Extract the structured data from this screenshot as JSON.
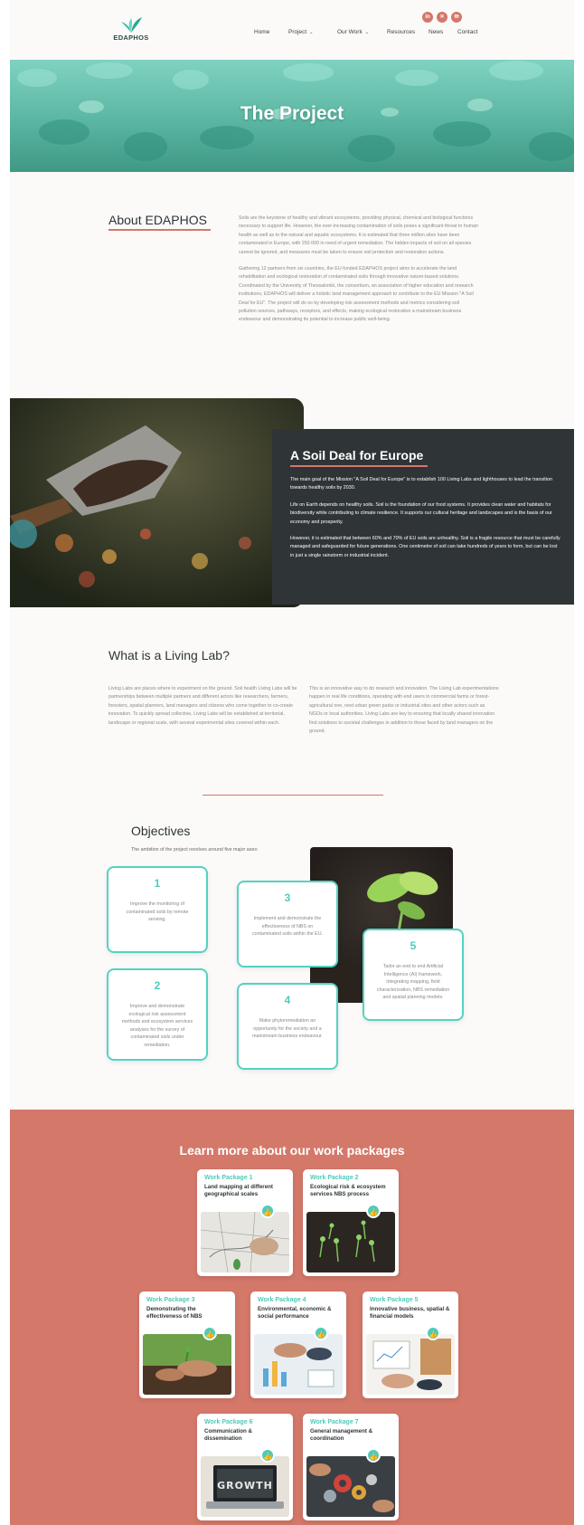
{
  "brand": {
    "name": "EDAPHOS"
  },
  "social": [
    {
      "icon": "linkedin-icon",
      "glyph": "in"
    },
    {
      "icon": "twitter-icon",
      "glyph": "✕"
    },
    {
      "icon": "email-icon",
      "glyph": "✉"
    }
  ],
  "nav": {
    "home": "Home",
    "project": "Project",
    "our_work": "Our Work",
    "resources": "Resources",
    "news": "News",
    "contact": "Contact",
    "chevron": "⌄"
  },
  "hero": {
    "title": "The Project"
  },
  "about": {
    "title": "About EDAPHOS",
    "p1": "Soils are the keystone of healthy and vibrant ecosystems, providing physical, chemical and biological functions necessary to support life. However, the ever-increasing contamination of soils poses a significant threat to human health as well as to the natural and aquatic ecosystems. It is estimated that three million sites have been contaminated in Europe, with 250 000 in need of urgent remediation. The hidden impacts of soil on all species cannot be ignored, and measures must be taken to ensure soil protection and restoration actions.",
    "p2": "Gathering 12 partners from six countries, the EU-funded EDAPHOS project aims to accelerate the land rehabilitation and ecological restoration of contaminated soils through innovative nature-based solutions. Coordinated by the University of Thessaloniki, the consortium, an association of higher education and research institutions, EDAPHOS will deliver a holistic land management approach to contribute to the EU Mission \"A Soil Deal for EU\". The project will do so by developing risk assessment methods and metrics considering soil pollution sources, pathways, receptors, and effects, making ecological restoration a mainstream business endeavour and demonstrating its potential to increase public well-being."
  },
  "soil_deal": {
    "title": "A Soil Deal for Europe",
    "p1": "The main goal of the Mission \"A Soil Deal for Europe\" is to establish 100 Living Labs and lighthouses to lead the transition towards healthy soils by 2030.",
    "p2": "Life on Earth depends on healthy soils. Soil is the foundation of our food systems. It provides clean water and habitats for biodiversity while contributing to climate resilience. It supports our cultural heritage and landscapes and is the basis of our economy and prosperity.",
    "p3": "However, it is estimated that between 60% and 70% of EU soils are unhealthy. Soil is a fragile resource that must be carefully managed and safeguarded for future generations. One centimetre of soil can take hundreds of years to form, but can be lost in just a single rainstorm or industrial incident."
  },
  "living_lab": {
    "title": "What is a Living Lab?",
    "col1": "Living Labs are places where to experiment on the ground. Soil health Living Labs will be partnerships between multiple partners and different actors like researchers, farmers, foresters, spatial planners, land managers and citizens who come together to co-create innovation. To quickly spread collective, Living Labs will be established at territorial, landscape or regional scale, with several experimental sites covered within each.",
    "col2": "This is an innovative way to do research and innovation. The Living Lab experimentations happen in real life conditions, operating with end users in commercial farms or forest-agricultural one, next urban green parks or industrial sites and other actors such as NGOs or local authorities. Living Labs are key to ensuring that locally shared innovation find solutions to societal challenges in addition to those faced by land managers on the ground."
  },
  "objectives": {
    "title": "Objectives",
    "subtitle": "The ambition of the project revolves around five major axes:",
    "items": [
      {
        "num": "1",
        "text": "Improve the monitoring of contaminated soils by remote sensing."
      },
      {
        "num": "2",
        "text": "Improve and demonstrate ecological risk assessment methods and ecosystem services analyses for the survey of contaminated soils under remediation."
      },
      {
        "num": "3",
        "text": "Implement and demonstrate the effectiveness of NBS on contaminated soils within the EU."
      },
      {
        "num": "4",
        "text": "Make phytoremediation an opportunity for the society and a mainstream business endeavour."
      },
      {
        "num": "5",
        "text": "Tailor an end to end Artificial Intelligence (AI) framework, integrating mapping, field characterization, NBS remediation and spatial planning models."
      }
    ]
  },
  "work_packages": {
    "heading": "Learn more about our work packages",
    "badge_glyph": "👍",
    "items": [
      {
        "label": "Work Package 1",
        "desc": "Land mapping at different geographical scales"
      },
      {
        "label": "Work Package 2",
        "desc": "Ecological risk & ecosystem services NBS process"
      },
      {
        "label": "Work Package 3",
        "desc": "Demonstrating the effectiveness of NBS"
      },
      {
        "label": "Work Package 4",
        "desc": "Environmental, economic & social performance"
      },
      {
        "label": "Work Package 5",
        "desc": "Innovative business, spatial & financial models"
      },
      {
        "label": "Work Package 6",
        "desc": "Communication & dissemination"
      },
      {
        "label": "Work Package 7",
        "desc": "General management & coordination"
      }
    ]
  },
  "colors": {
    "accent": "#d4776a",
    "teal": "#4ecbbb",
    "dark": "#2f3437"
  }
}
